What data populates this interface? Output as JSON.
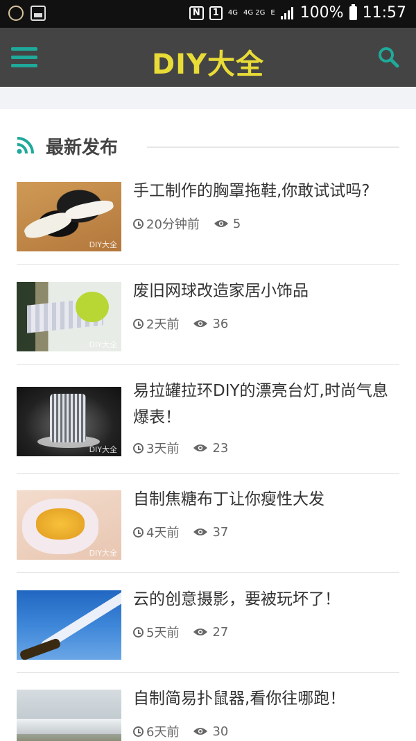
{
  "status_bar": {
    "battery": "100%",
    "time": "11:57",
    "sim": "1",
    "net1": "4G",
    "net2": "4G 2G",
    "net3": "E"
  },
  "header": {
    "logo": "DIY大全",
    "menu_icon": "menu-icon",
    "search_icon": "search-icon"
  },
  "section": {
    "title": "最新发布",
    "icon": "rss-icon"
  },
  "articles": [
    {
      "title": "手工制作的胸罩拖鞋,你敢试试吗?",
      "time": "20分钟前",
      "views": "5",
      "watermark": "DIY大全"
    },
    {
      "title": "废旧网球改造家居小饰品",
      "time": "2天前",
      "views": "36",
      "watermark": "DIY大全"
    },
    {
      "title": "易拉罐拉环DIY的漂亮台灯,时尚气息爆表！",
      "time": "3天前",
      "views": "23",
      "watermark": "DIY大全"
    },
    {
      "title": "自制焦糖布丁让你瘦性大发",
      "time": "4天前",
      "views": "37",
      "watermark": "DIY大全"
    },
    {
      "title": "云的创意摄影，要被玩坏了！",
      "time": "5天前",
      "views": "27",
      "watermark": ""
    },
    {
      "title": "自制简易扑鼠器,看你往哪跑！",
      "time": "6天前",
      "views": "30",
      "watermark": ""
    }
  ],
  "colors": {
    "accent": "#1fa99a",
    "logo": "#e9dc37",
    "header_bg": "#444444"
  }
}
